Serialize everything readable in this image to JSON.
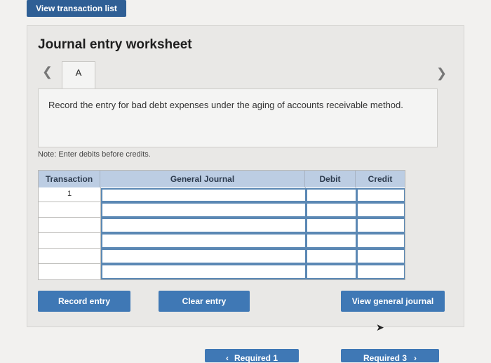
{
  "top_button": {
    "label": "View transaction list"
  },
  "worksheet": {
    "title": "Journal entry worksheet",
    "tab_label": "A",
    "instruction": "Record the entry for bad debt expenses under the aging of accounts receivable method.",
    "note": "Note: Enter debits before credits."
  },
  "table": {
    "headers": [
      "Transaction",
      "General Journal",
      "Debit",
      "Credit"
    ],
    "first_transaction": "1"
  },
  "actions": {
    "record": "Record entry",
    "clear": "Clear entry",
    "view_journal": "View general journal"
  },
  "footer": {
    "prev": "Required 1",
    "next": "Required 3"
  },
  "icons": {
    "prev_arrow": "chevron-left-icon",
    "next_arrow": "chevron-right-icon"
  },
  "colors": {
    "primary_button": "#3f78b5",
    "header_bg": "#bccde3"
  }
}
